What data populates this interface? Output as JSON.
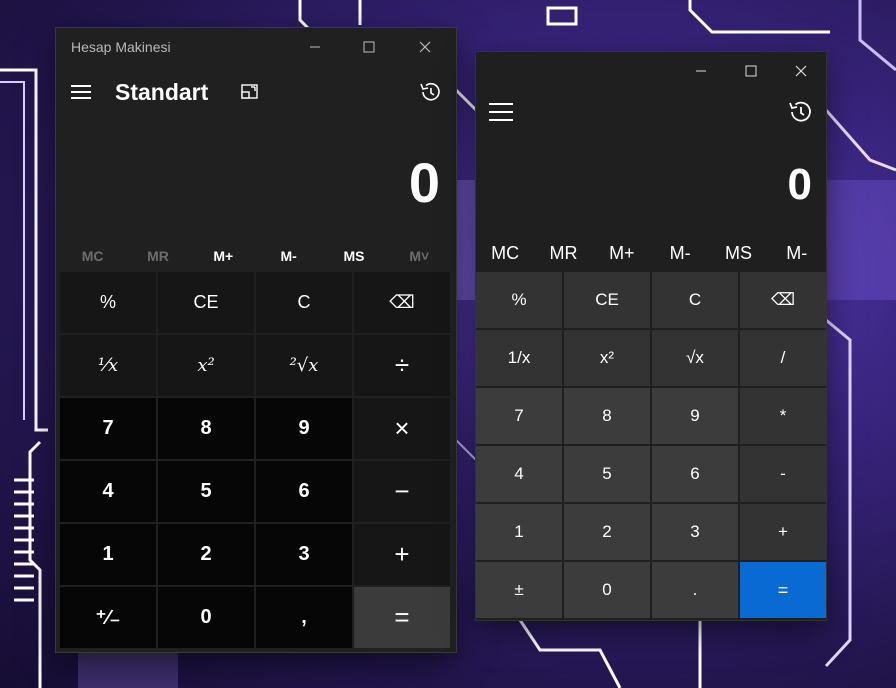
{
  "calculator_standard": {
    "window_title": "Hesap Makinesi",
    "mode_title": "Standart",
    "display_value": "0",
    "memory_buttons": [
      {
        "label": "MC",
        "enabled": false
      },
      {
        "label": "MR",
        "enabled": false
      },
      {
        "label": "M+",
        "enabled": true
      },
      {
        "label": "M-",
        "enabled": true
      },
      {
        "label": "MS",
        "enabled": true
      },
      {
        "label": "M˅",
        "enabled": false
      }
    ],
    "keys": [
      {
        "label": "%",
        "kind": "fn",
        "name": "percent-button"
      },
      {
        "label": "CE",
        "kind": "fn",
        "name": "clear-entry-button"
      },
      {
        "label": "C",
        "kind": "fn",
        "name": "clear-button"
      },
      {
        "label": "⌫",
        "kind": "fn",
        "name": "backspace-button"
      },
      {
        "label": "¹⁄x",
        "kind": "fn",
        "name": "reciprocal-button"
      },
      {
        "label": "x²",
        "kind": "fn",
        "name": "square-button"
      },
      {
        "label": "²√x",
        "kind": "fn",
        "name": "square-root-button"
      },
      {
        "label": "÷",
        "kind": "fn op",
        "name": "divide-button"
      },
      {
        "label": "7",
        "kind": "num",
        "name": "digit-7-button"
      },
      {
        "label": "8",
        "kind": "num",
        "name": "digit-8-button"
      },
      {
        "label": "9",
        "kind": "num",
        "name": "digit-9-button"
      },
      {
        "label": "×",
        "kind": "fn op",
        "name": "multiply-button"
      },
      {
        "label": "4",
        "kind": "num",
        "name": "digit-4-button"
      },
      {
        "label": "5",
        "kind": "num",
        "name": "digit-5-button"
      },
      {
        "label": "6",
        "kind": "num",
        "name": "digit-6-button"
      },
      {
        "label": "−",
        "kind": "fn op",
        "name": "minus-button"
      },
      {
        "label": "1",
        "kind": "num",
        "name": "digit-1-button"
      },
      {
        "label": "2",
        "kind": "num",
        "name": "digit-2-button"
      },
      {
        "label": "3",
        "kind": "num",
        "name": "digit-3-button"
      },
      {
        "label": "+",
        "kind": "fn op",
        "name": "plus-button"
      },
      {
        "label": "⁺⁄₋",
        "kind": "num",
        "name": "negate-button"
      },
      {
        "label": "0",
        "kind": "num",
        "name": "digit-0-button"
      },
      {
        "label": ",",
        "kind": "num",
        "name": "decimal-button"
      },
      {
        "label": "=",
        "kind": "eq",
        "name": "equals-button"
      }
    ]
  },
  "calculator_clone": {
    "display_value": "0",
    "memory_buttons": [
      "MC",
      "MR",
      "M+",
      "M-",
      "MS",
      "M-"
    ],
    "keys": [
      {
        "label": "%",
        "kind": "fn",
        "name": "percent-button"
      },
      {
        "label": "CE",
        "kind": "fn",
        "name": "clear-entry-button"
      },
      {
        "label": "C",
        "kind": "fn",
        "name": "clear-button"
      },
      {
        "label": "⌫",
        "kind": "fn",
        "name": "backspace-button"
      },
      {
        "label": "1/x",
        "kind": "fn",
        "name": "reciprocal-button"
      },
      {
        "label": "x²",
        "kind": "fn",
        "name": "square-button"
      },
      {
        "label": "√x",
        "kind": "fn",
        "name": "square-root-button"
      },
      {
        "label": "/",
        "kind": "fn",
        "name": "divide-button"
      },
      {
        "label": "7",
        "kind": "num",
        "name": "digit-7-button"
      },
      {
        "label": "8",
        "kind": "num",
        "name": "digit-8-button"
      },
      {
        "label": "9",
        "kind": "num",
        "name": "digit-9-button"
      },
      {
        "label": "*",
        "kind": "fn",
        "name": "multiply-button"
      },
      {
        "label": "4",
        "kind": "num",
        "name": "digit-4-button"
      },
      {
        "label": "5",
        "kind": "num",
        "name": "digit-5-button"
      },
      {
        "label": "6",
        "kind": "num",
        "name": "digit-6-button"
      },
      {
        "label": "-",
        "kind": "fn",
        "name": "minus-button"
      },
      {
        "label": "1",
        "kind": "num",
        "name": "digit-1-button"
      },
      {
        "label": "2",
        "kind": "num",
        "name": "digit-2-button"
      },
      {
        "label": "3",
        "kind": "num",
        "name": "digit-3-button"
      },
      {
        "label": "+",
        "kind": "fn",
        "name": "plus-button"
      },
      {
        "label": "±",
        "kind": "num",
        "name": "negate-button"
      },
      {
        "label": "0",
        "kind": "num",
        "name": "digit-0-button"
      },
      {
        "label": ".",
        "kind": "num",
        "name": "decimal-button"
      },
      {
        "label": "=",
        "kind": "eq",
        "name": "equals-button"
      }
    ]
  },
  "icons": {
    "menu": "hamburger-icon",
    "keep_on_top": "keep-on-top-icon",
    "history": "history-icon",
    "minimize": "minimize-icon",
    "maximize": "maximize-icon",
    "close": "close-icon"
  }
}
